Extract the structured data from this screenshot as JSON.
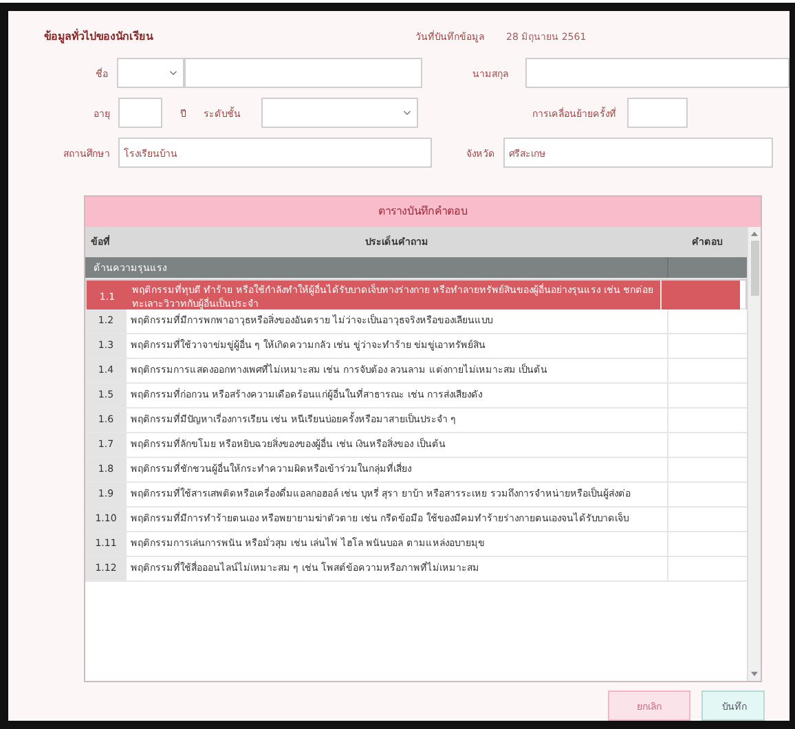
{
  "form": {
    "title": "ข้อมูลทั่วไปของนักเรียน",
    "date_label": "วันที่บันทึกข้อมูล",
    "date_value": "28 มิถุนายน 2561",
    "name_label": "ชื่อ",
    "surname_label": "นามสกุล",
    "age_label": "อายุ",
    "age_unit": "ปี",
    "grade_label": "ระดับชั้น",
    "move_label": "การเคลื่อนย้ายครั้งที่",
    "school_label": "สถานศึกษา",
    "school_value": "โรงเรียนบ้าน",
    "province_label": "จังหวัด",
    "province_value": "ศรีสะเกษ"
  },
  "table": {
    "title": "ตารางบันทึกคำตอบ",
    "columns": [
      "ข้อที่",
      "ประเด็นคำถาม",
      "คำตอบ"
    ],
    "rows": [
      {
        "kind": "group",
        "question": "ด้านความรุนแรง",
        "selected": false
      },
      {
        "kind": "item",
        "number": "1.1",
        "question": "พฤติกรรมที่ทุบตี ทำร้าย หรือใช้กำลังทำให้ผู้อื่นได้รับบาดเจ็บทางร่างกาย หรือทำลายทรัพย์สินของผู้อื่นอย่างรุนแรง เช่น ชกต่อยทะเลาะวิวาทกับผู้อื่นเป็นประจำ",
        "selected": true
      },
      {
        "kind": "item",
        "number": "1.2",
        "question": "พฤติกรรมที่มีการพกพาอาวุธหรือสิ่งของอันตราย ไม่ว่าจะเป็นอาวุธจริงหรือของเลียนแบบ",
        "selected": false
      },
      {
        "kind": "item",
        "number": "1.3",
        "question": "พฤติกรรมที่ใช้วาจาข่มขู่ผู้อื่น ๆ ให้เกิดความกลัว เช่น ขู่ว่าจะทำร้าย ข่มขู่เอาทรัพย์สิน",
        "selected": false
      },
      {
        "kind": "item",
        "number": "1.4",
        "question": "พฤติกรรมการแสดงออกทางเพศที่ไม่เหมาะสม เช่น การจับต้อง ลวนลาม แต่งกายไม่เหมาะสม เป็นต้น",
        "selected": false
      },
      {
        "kind": "item",
        "number": "1.5",
        "question": "พฤติกรรมที่ก่อกวน หรือสร้างความเดือดร้อนแก่ผู้อื่นในที่สาธารณะ เช่น การส่งเสียงดัง",
        "selected": false
      },
      {
        "kind": "item",
        "number": "1.6",
        "question": "พฤติกรรมที่มีปัญหาเรื่องการเรียน เช่น หนีเรียนบ่อยครั้งหรือมาสายเป็นประจำ ๆ",
        "selected": false
      },
      {
        "kind": "item",
        "number": "1.7",
        "question": "พฤติกรรมที่ลักขโมย หรือหยิบฉวยสิ่งของของผู้อื่น เช่น เงินหรือสิ่งของ เป็นต้น",
        "selected": false
      },
      {
        "kind": "item",
        "number": "1.8",
        "question": "พฤติกรรมที่ชักชวนผู้อื่นให้กระทำความผิดหรือเข้าร่วมในกลุ่มที่เสี่ยง",
        "selected": false
      },
      {
        "kind": "item",
        "number": "1.9",
        "question": "พฤติกรรมที่ใช้สารเสพติดหรือเครื่องดื่มแอลกอฮอล์ เช่น บุหรี่ สุรา ยาบ้า หรือสารระเหย รวมถึงการจำหน่ายหรือเป็นผู้ส่งต่อ",
        "selected": false
      },
      {
        "kind": "item",
        "number": "1.10",
        "question": "พฤติกรรมที่มีการทำร้ายตนเอง หรือพยายามฆ่าตัวตาย เช่น กรีดข้อมือ ใช้ของมีคมทำร้ายร่างกายตนเองจนได้รับบาดเจ็บ",
        "selected": false
      },
      {
        "kind": "item",
        "number": "1.11",
        "question": "พฤติกรรมการเล่นการพนัน หรือมั่วสุม เช่น เล่นไพ่ ไฮโล พนันบอล ตามแหล่งอบายมุข",
        "selected": false
      },
      {
        "kind": "item",
        "number": "1.12",
        "question": "พฤติกรรมที่ใช้สื่อออนไลน์ไม่เหมาะสม ๆ เช่น โพสต์ข้อความหรือภาพที่ไม่เหมาะสม",
        "selected": false
      }
    ]
  },
  "buttons": [
    {
      "kind": "cancel",
      "label": "ยกเลิก"
    },
    {
      "kind": "save",
      "label": "บันทึก"
    }
  ]
}
